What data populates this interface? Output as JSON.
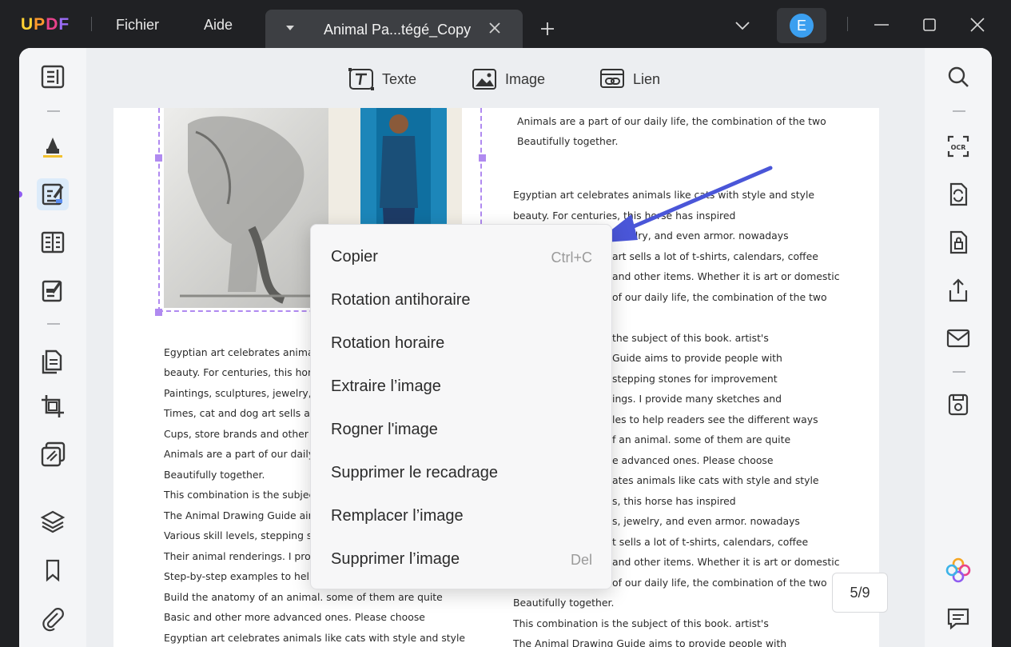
{
  "titlebar": {
    "logo": {
      "u": "U",
      "p": "P",
      "d": "D",
      "f": "F"
    },
    "menus": [
      "Fichier",
      "Aide"
    ],
    "tab_title": "Animal Pa...tégé_Copy",
    "avatar_letter": "E"
  },
  "edit_toolbar": {
    "text_label": "Texte",
    "image_label": "Image",
    "link_label": "Lien"
  },
  "document": {
    "right_column": [
      "Animals are a part of our daily life, the combination of the two",
      "Beautifully together.",
      "Egyptian art celebrates animals like cats with style and style",
      "beauty. For centuries, this horse has inspired",
      "jewelry, and even armor. nowadays",
      "art sells a lot of t-shirts, calendars, coffee",
      "and other items. Whether it is art or domestic",
      "of our daily life, the combination of the two",
      "the subject of this book. artist's",
      "Guide aims to provide people with",
      "stepping stones for improvement",
      "ings. I provide many sketches and",
      "les to help readers see the different ways",
      "f an animal. some of them are quite",
      "e advanced ones. Please choose",
      "ates animals like cats with style and style",
      "s, this horse has inspired",
      "s, jewelry, and even armor. nowadays",
      "t sells a lot of t-shirts, calendars, coffee",
      "and other items. Whether it is art or domestic",
      "of our daily life, the combination of the two",
      "Beautifully together.",
      "This combination is the subject of this book. artist's",
      "The Animal Drawing Guide aims to provide people with"
    ],
    "left_column": [
      "Egyptian art celebrates anima",
      "beauty. For centuries, this hor",
      "Paintings, sculptures, jewelry,",
      "Times, cat and dog art sells a l",
      "Cups, store brands and other i",
      "Animals are a part of our daily",
      "Beautifully together.",
      "This combination is the subjec",
      "The Animal Drawing Guide aim",
      "Various skill levels, stepping s",
      "Their animal renderings. I prov",
      "Step-by-step examples to help",
      "Build the anatomy of an animal. some of them are quite",
      "Basic and other more advanced ones. Please choose",
      "Egyptian art celebrates animals like cats with style and style"
    ]
  },
  "context_menu": {
    "items": [
      {
        "label": "Copier",
        "shortcut": "Ctrl+C"
      },
      {
        "label": "Rotation antihoraire",
        "shortcut": ""
      },
      {
        "label": "Rotation horaire",
        "shortcut": ""
      },
      {
        "label": "Extraire l’image",
        "shortcut": ""
      },
      {
        "label": "Rogner l'image",
        "shortcut": ""
      },
      {
        "label": "Supprimer le recadrage",
        "shortcut": ""
      },
      {
        "label": "Remplacer l’image",
        "shortcut": ""
      },
      {
        "label": "Supprimer l’image",
        "shortcut": "Del"
      }
    ]
  },
  "page_indicator": "5/9",
  "colors": {
    "accent": "#8f5cf0",
    "selection": "#b08af0",
    "arrow": "#4a56d8",
    "avatar": "#3b9ff0"
  },
  "icons": {
    "left_sidebar": [
      "reader-icon",
      "highlighter-icon",
      "edit-pdf-icon",
      "form-icon",
      "sign-icon",
      "organize-pages-icon",
      "crop-icon",
      "batch-icon",
      "layers-icon",
      "bookmark-icon",
      "attachment-icon"
    ],
    "right_sidebar": [
      "search-icon",
      "ocr-icon",
      "convert-icon",
      "protect-icon",
      "share-icon",
      "email-icon",
      "save-icon",
      "ai-icon",
      "comment-icon"
    ]
  }
}
